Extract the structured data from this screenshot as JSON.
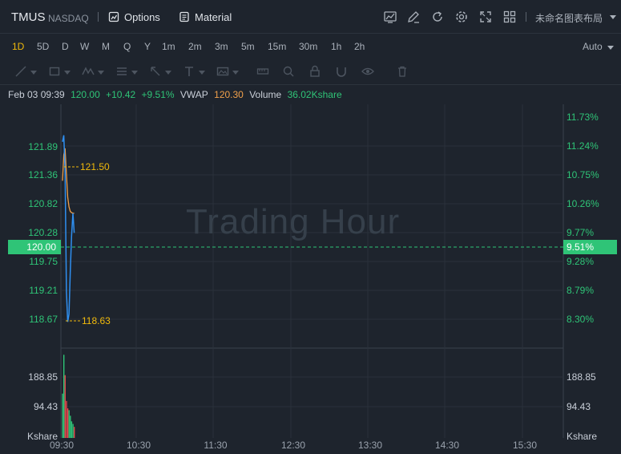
{
  "header": {
    "symbol": "TMUS",
    "exchange": "NASDAQ",
    "options_label": "Options",
    "material_label": "Material",
    "layout_label": "未命名图表布局",
    "icons": [
      "line-chart-icon",
      "edit-icon",
      "refresh-icon",
      "settings-icon",
      "fullscreen-icon",
      "grid-layout-icon"
    ]
  },
  "intervals": {
    "items": [
      "1D",
      "5D",
      "D",
      "W",
      "M",
      "Q",
      "Y",
      "1m",
      "2m",
      "3m",
      "5m",
      "15m",
      "30m",
      "1h",
      "2h"
    ],
    "active": "1D",
    "scale_mode": "Auto"
  },
  "info": {
    "datetime": "Feb 03 09:39",
    "price": "120.00",
    "change": "+10.42",
    "change_pct": "+9.51%",
    "vwap_label": "VWAP",
    "vwap": "120.30",
    "volume_label": "Volume",
    "volume": "36.02Kshare"
  },
  "chart": {
    "watermark": "Trading Hour",
    "price_axis_left": [
      "121.89",
      "121.36",
      "120.82",
      "120.28",
      "119.75",
      "119.21",
      "118.67"
    ],
    "pct_axis_right": [
      "11.73%",
      "11.24%",
      "10.75%",
      "10.26%",
      "9.77%",
      "9.28%",
      "8.79%",
      "8.30%"
    ],
    "current_price": "120.00",
    "current_pct": "9.51%",
    "high_label": "121.50",
    "low_label": "118.63",
    "volume_axis_left": [
      "188.85",
      "94.43",
      "Kshare"
    ],
    "volume_axis_right": [
      "188.85",
      "94.43",
      "Kshare"
    ],
    "time_axis": [
      "09:30",
      "10:30",
      "11:30",
      "12:30",
      "13:30",
      "14:30",
      "15:30"
    ],
    "colors": {
      "up": "#2fc477",
      "down": "#e2474b",
      "price_line": "#2f8ff0",
      "vwap_line": "#f0a04b",
      "marker": "#f0b90b"
    }
  },
  "chart_data": {
    "type": "line",
    "title": "",
    "x": [
      "09:30",
      "09:31",
      "09:32",
      "09:33",
      "09:34",
      "09:35",
      "09:36",
      "09:37",
      "09:38",
      "09:39"
    ],
    "series": [
      {
        "name": "",
        "values": [
          121.4,
          121.5,
          120.95,
          119.1,
          118.63,
          118.75,
          119.4,
          119.95,
          120.3,
          120.0
        ]
      },
      {
        "name": "VWAP",
        "values": [
          120.8,
          121.2,
          121.3,
          120.9,
          120.55,
          120.4,
          120.33,
          120.31,
          120.3,
          120.3
        ]
      }
    ],
    "volume": {
      "name": "Volume",
      "unit": "Kshare",
      "values": [
        120,
        225,
        170,
        100,
        80,
        75,
        60,
        45,
        38,
        30
      ]
    },
    "ylim": [
      118.4,
      122.1
    ],
    "xlim": [
      "09:30",
      "16:00"
    ]
  }
}
